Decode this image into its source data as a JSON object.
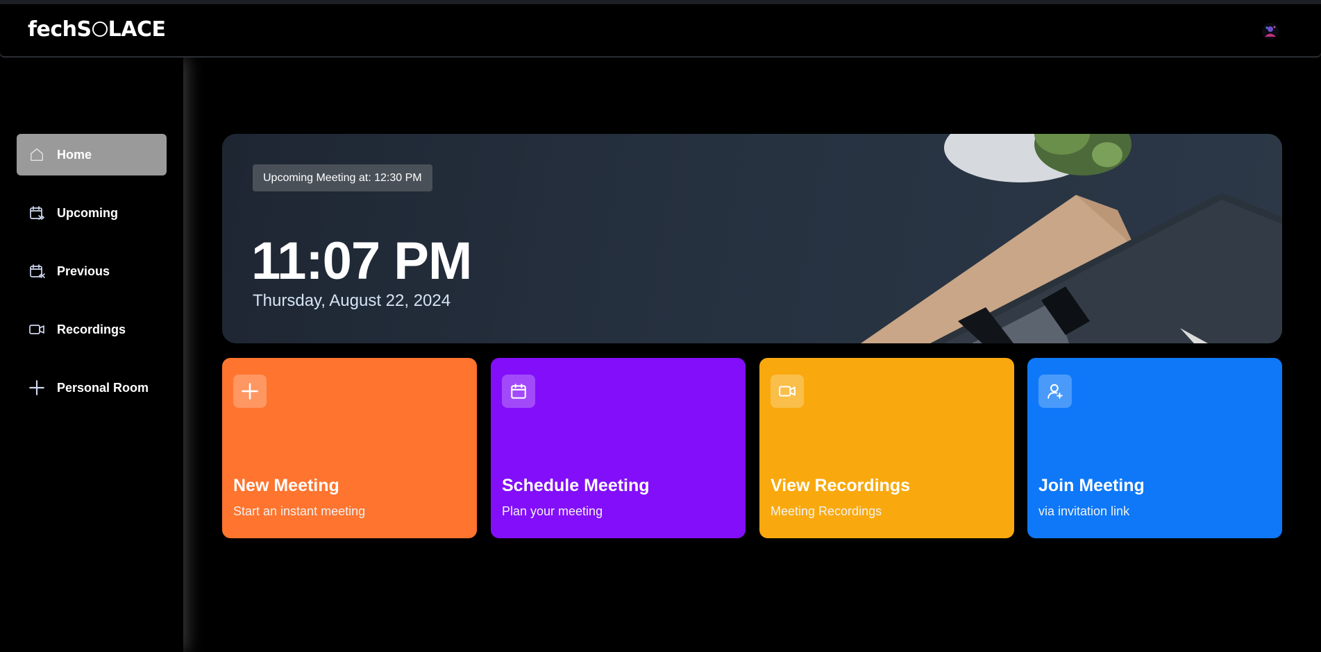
{
  "brand": {
    "logo_pre": "fechS",
    "logo_post": "LACE"
  },
  "sidebar": {
    "items": [
      {
        "label": "Home",
        "icon": "home-icon",
        "active": true
      },
      {
        "label": "Upcoming",
        "icon": "calendar-forward-icon"
      },
      {
        "label": "Previous",
        "icon": "calendar-back-icon"
      },
      {
        "label": "Recordings",
        "icon": "video-icon"
      },
      {
        "label": "Personal Room",
        "icon": "plus-icon"
      }
    ]
  },
  "hero": {
    "upcoming_badge": "Upcoming Meeting at: 12:30 PM",
    "time": "11:07 PM",
    "date": "Thursday, August 22, 2024"
  },
  "cards": [
    {
      "title": "New Meeting",
      "subtitle": "Start an instant meeting",
      "icon": "plus-icon",
      "color": "#ff742e"
    },
    {
      "title": "Schedule Meeting",
      "subtitle": "Plan your meeting",
      "icon": "calendar-icon",
      "color": "#830ef9"
    },
    {
      "title": "View Recordings",
      "subtitle": "Meeting Recordings",
      "icon": "video-icon",
      "color": "#f9a90e"
    },
    {
      "title": "Join Meeting",
      "subtitle": "via invitation link",
      "icon": "user-plus-icon",
      "color": "#0e78f9"
    }
  ],
  "colors": {
    "sidebar_active": "#9a9a9a",
    "badge_bg": "#4a5058",
    "date_text": "#d6e4f5"
  }
}
